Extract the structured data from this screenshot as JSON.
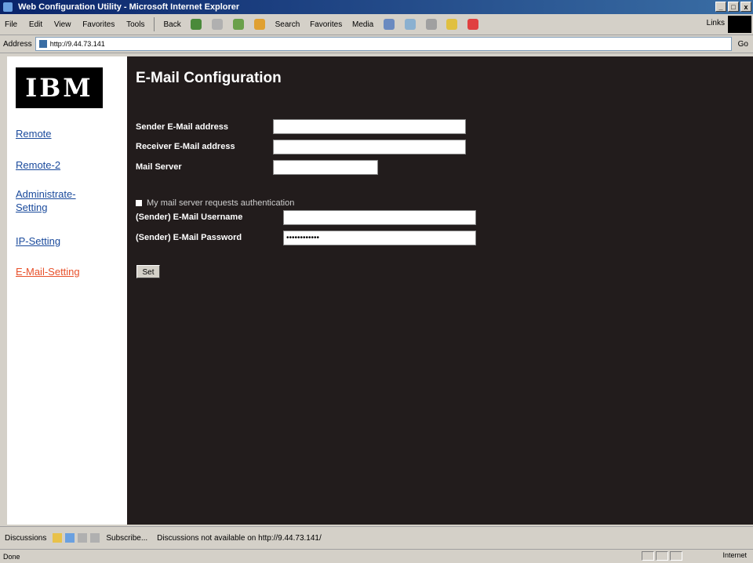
{
  "window": {
    "title": "Web Configuration Utility - Microsoft Internet Explorer",
    "controls": [
      "_",
      "□",
      "x"
    ]
  },
  "menu": [
    "File",
    "Edit",
    "View",
    "Favorites",
    "Tools"
  ],
  "toolbar": {
    "back": "Back",
    "search": "Search",
    "favorites": "Favorites",
    "media": "Media",
    "links": "Links"
  },
  "address": {
    "label": "Address",
    "url": "http://9.44.73.141",
    "go": "Go"
  },
  "sidebar": {
    "logo": "IBM",
    "items": [
      {
        "label": "Remote"
      },
      {
        "label": "Remote-2"
      },
      {
        "label": "Administrate-Setting"
      },
      {
        "label": "IP-Setting"
      },
      {
        "label": "E-Mail-Setting"
      }
    ]
  },
  "main": {
    "title": "E-Mail Configuration",
    "fields": {
      "sender_label": "Sender E-Mail address",
      "receiver_label": "Receiver E-Mail address",
      "server_label": "Mail Server",
      "auth_label": "My mail server requests authentication",
      "username_label": "(Sender) E-Mail Username",
      "password_label": "(Sender) E-Mail Password",
      "sender_value": "",
      "receiver_value": "",
      "server_value": "",
      "username_value": "",
      "password_value": "••••••••••••"
    },
    "set_button": "Set"
  },
  "discussions": {
    "label": "Discussions",
    "subscribe": "Subscribe...",
    "message": "Discussions not available on http://9.44.73.141/"
  },
  "status": {
    "text": "Done",
    "zone": "Internet"
  },
  "colors": {
    "main_bg": "#221c1c",
    "link": "#1a4a9c",
    "active_link": "#e8502a",
    "chrome": "#d4d0c8"
  }
}
